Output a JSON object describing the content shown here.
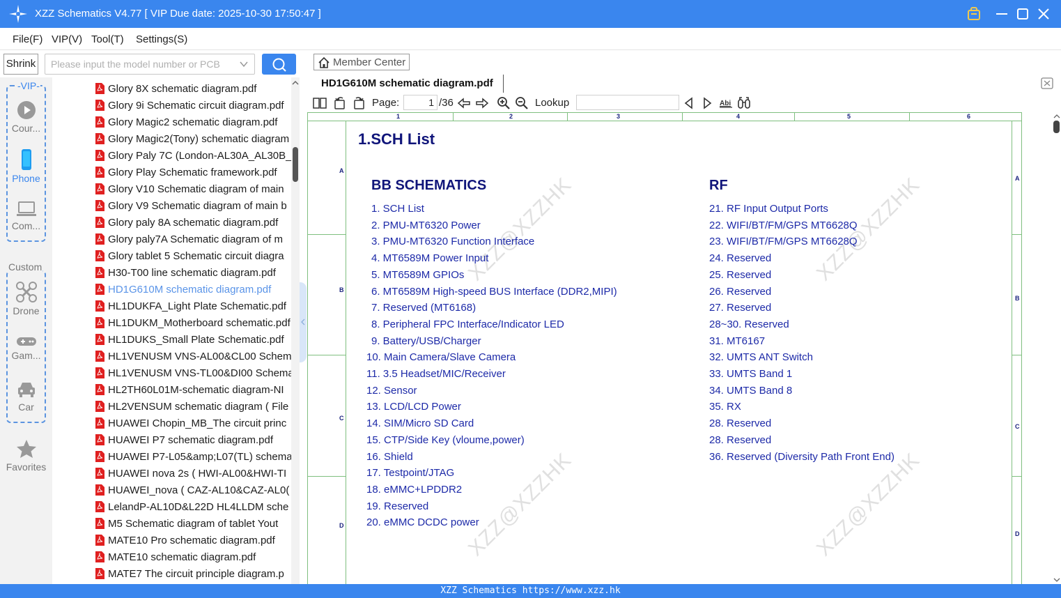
{
  "window": {
    "title": "XZZ Schematics V4.77 [ VIP Due date: 2025-10-30 17:50:47 ]"
  },
  "menu": {
    "items": [
      "File(F)",
      "VIP(V)",
      "Tool(T)",
      "Settings(S)"
    ]
  },
  "search": {
    "shrink_label": "Shrink",
    "placeholder": "Please input the model number or PCB"
  },
  "categories": {
    "vip_label": "-VIP-",
    "custom_label": "Custom",
    "items": [
      {
        "label": "Cour...",
        "icon": "play-circle-icon"
      },
      {
        "label": "Phone",
        "icon": "phone-icon"
      },
      {
        "label": "Com...",
        "icon": "laptop-icon"
      },
      {
        "label": "Drone",
        "icon": "drone-icon"
      },
      {
        "label": "Gam...",
        "icon": "gamepad-icon"
      },
      {
        "label": "Car",
        "icon": "car-icon"
      }
    ],
    "favorites_label": "Favorites"
  },
  "file_list": {
    "selected_index": 12,
    "items": [
      "Glory 8X schematic diagram.pdf",
      "Glory 9i Schematic circuit diagram.pdf",
      "Glory Magic2 schematic diagram.pdf",
      "Glory Magic2(Tony) schematic diagram",
      "Glory Paly 7C (London-AL30A_AL30B_",
      "Glory Play Schematic framework.pdf",
      "Glory V10 Schematic diagram of main",
      "Glory V9 Schematic diagram of main b",
      "Glory paly 8A schematic diagram.pdf",
      "Glory paly7A Schematic diagram of m",
      "Glory tablet 5 Schematic circuit diagra",
      "H30-T00 line schematic diagram.pdf",
      "HD1G610M schematic diagram.pdf",
      "HL1DUKFA_Light Plate Schematic.pdf",
      "HL1DUKM_Motherboard schematic.pdf",
      "HL1DUKS_Small Plate Schematic.pdf",
      "HL1VENUSM VNS-AL00&CL00 Schem",
      "HL1VENUSM VNS-TL00&DI00 Schema",
      "HL2TH60L01M-schematic diagram-NI",
      "HL2VENSUM schematic diagram ( File",
      "HUAWEI Chopin_MB_The circuit princ",
      "HUAWEI P7 schematic diagram.pdf",
      "HUAWEI P7-L05&amp;L07(TL) schema",
      "HUAWEI nova 2s ( HWI-AL00&HWI-TI",
      "HUAWEI_nova ( CAZ-AL10&CAZ-AL0(",
      "LelandP-AL10D&L22D HL4LLDM sche",
      "M5 Schematic diagram of tablet Yout",
      "MATE10 Pro schematic diagram.pdf",
      "MATE10 schematic diagram.pdf",
      "MATE7 The circuit principle diagram.p"
    ]
  },
  "viewer": {
    "member_center_label": "Member Center",
    "doc_tab_label": "HD1G610M schematic diagram.pdf",
    "page_label": "Page:",
    "page_value": "1",
    "page_total": "/36",
    "lookup_label": "Lookup",
    "toolbar_icons": [
      "dual-page-icon",
      "rotate-left-icon",
      "rotate-right-icon",
      "prev-page-icon",
      "next-page-icon",
      "zoom-in-icon",
      "zoom-out-icon",
      "find-prev-icon",
      "find-next-icon",
      "match-case-icon",
      "find-all-icon"
    ]
  },
  "document": {
    "col_labels": [
      "1",
      "2",
      "3",
      "4",
      "5",
      "6"
    ],
    "row_labels": [
      "A",
      "B",
      "C",
      "D"
    ],
    "sheet_title": "1.SCH List",
    "watermark": "XZZ@XZZHK",
    "sections": [
      {
        "title": "BB SCHEMATICS",
        "entries": [
          "1. SCH List",
          "2. PMU-MT6320 Power",
          "3. PMU-MT6320 Function Interface",
          "4. MT6589M Power Input",
          "5. MT6589M GPIOs",
          "6. MT6589M High-speed BUS Interface (DDR2,MIPI)",
          "7. Reserved (MT6168)",
          "8. Peripheral FPC Interface/Indicator LED",
          "9. Battery/USB/Charger",
          "10. Main Camera/Slave Camera",
          "11. 3.5 Headset/MIC/Receiver",
          "12. Sensor",
          "13. LCD/LCD Power",
          "14. SIM/Micro SD Card",
          "15. CTP/Side Key (vloume,power)",
          "16. Shield",
          "17. Testpoint/JTAG",
          "18. eMMC+LPDDR2",
          "19. Reserved",
          "20. eMMC DCDC power"
        ]
      },
      {
        "title": "RF",
        "entries": [
          "21. RF Input Output Ports",
          "22. WIFI/BT/FM/GPS MT6628Q",
          "23. WIFI/BT/FM/GPS MT6628Q",
          "24. Reserved",
          "25. Reserved",
          "26. Reserved",
          "27. Reserved",
          "28~30. Reserved",
          "31. MT6167",
          "32. UMTS ANT Switch",
          "33. UMTS Band 1",
          "34. UMTS Band 8",
          "35. RX",
          "28. Reserved",
          "28. Reserved",
          "36. Reserved (Diversity Path Front End)"
        ]
      }
    ]
  },
  "status_bar": {
    "text": "XZZ Schematics https://www.xzz.hk"
  },
  "colors": {
    "accent": "#3a86ee",
    "selected_file": "#5a94e8",
    "doc_text": "#1d2aa8",
    "doc_heading": "#10157a"
  }
}
